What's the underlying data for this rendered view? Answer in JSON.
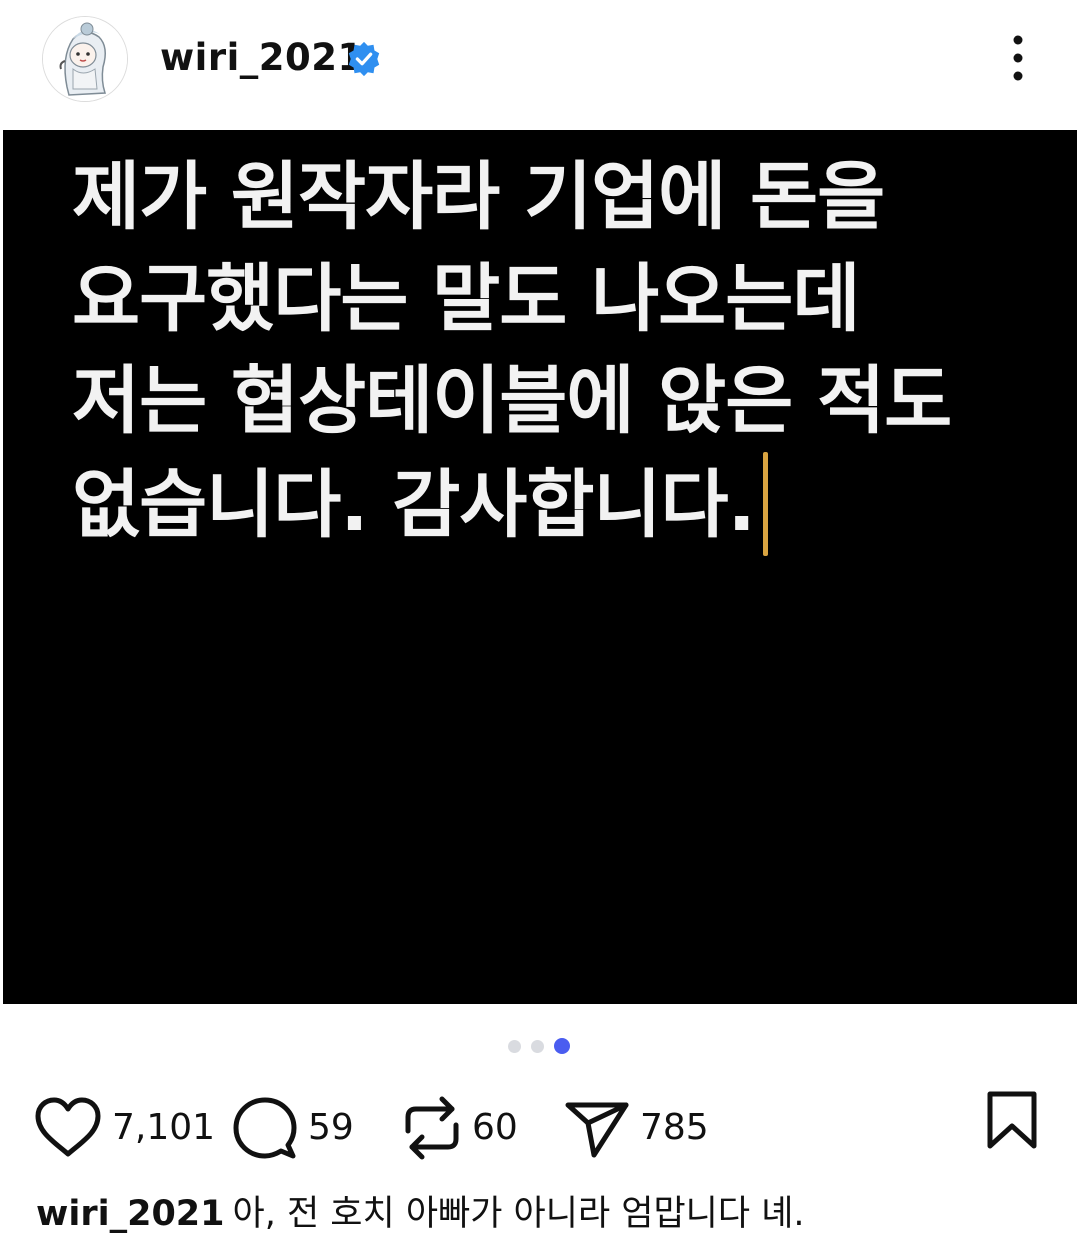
{
  "header": {
    "username": "wiri_2021",
    "verified": true,
    "avatar_icon": "avatar-character",
    "more_icon": "more-vertical-icon"
  },
  "post": {
    "image_text": "제가 원작자라 기업에 돈을 요구했다는 말도 나오는데 저는 협상테이블에 앉은 적도 없습니다. 감사합니다.",
    "carousel": {
      "total": 3,
      "active": 3
    },
    "colors": {
      "accent": "#4a5df0",
      "verified": "#2f8ff0",
      "cursor": "#d9a441"
    }
  },
  "actions": {
    "likes": "7,101",
    "comments": "59",
    "reposts": "60",
    "shares": "785"
  },
  "caption": {
    "username": "wiri_2021",
    "text": "아, 전 호치 아빠가 아니라 엄맙니다 녜."
  }
}
